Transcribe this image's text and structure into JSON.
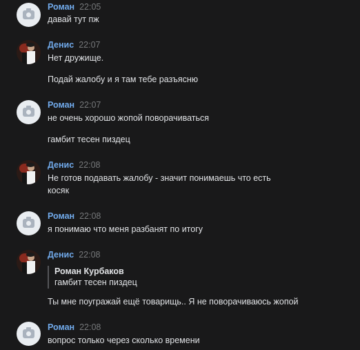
{
  "messages": [
    {
      "author": "Роман",
      "time": "22:05",
      "avatar": "camera-icon",
      "lines": [
        "давай тут пж"
      ]
    },
    {
      "author": "Денис",
      "time": "22:07",
      "avatar": "user-photo",
      "lines": [
        "Нет дружище.",
        "Подай жалобу и я там тебе разъясню"
      ]
    },
    {
      "author": "Роман",
      "time": "22:07",
      "avatar": "camera-icon",
      "lines": [
        "не очень хорошо жопой поворачиваться",
        "гамбит тесен пиздец"
      ]
    },
    {
      "author": "Денис",
      "time": "22:08",
      "avatar": "user-photo",
      "lines": [
        "Не готов подавать жалобу - значит понимаешь что есть",
        "косяк"
      ]
    },
    {
      "author": "Роман",
      "time": "22:08",
      "avatar": "camera-icon",
      "lines": [
        "я понимаю что меня разбанят по итогу"
      ]
    },
    {
      "author": "Денис",
      "time": "22:08",
      "avatar": "user-photo",
      "quote": {
        "author": "Роман Курбаков",
        "text": "гамбит тесен пиздец"
      },
      "lines": [
        "Ты мне поугражай ещё товарищь.. Я не поворачиваюсь жопой"
      ]
    },
    {
      "author": "Роман",
      "time": "22:08",
      "avatar": "camera-icon",
      "lines": [
        "вопрос только через сколько времени"
      ]
    }
  ],
  "colors": {
    "background": "#19191a",
    "author": "#71aaeb",
    "time": "#76787a",
    "text": "#e1e3e6"
  }
}
